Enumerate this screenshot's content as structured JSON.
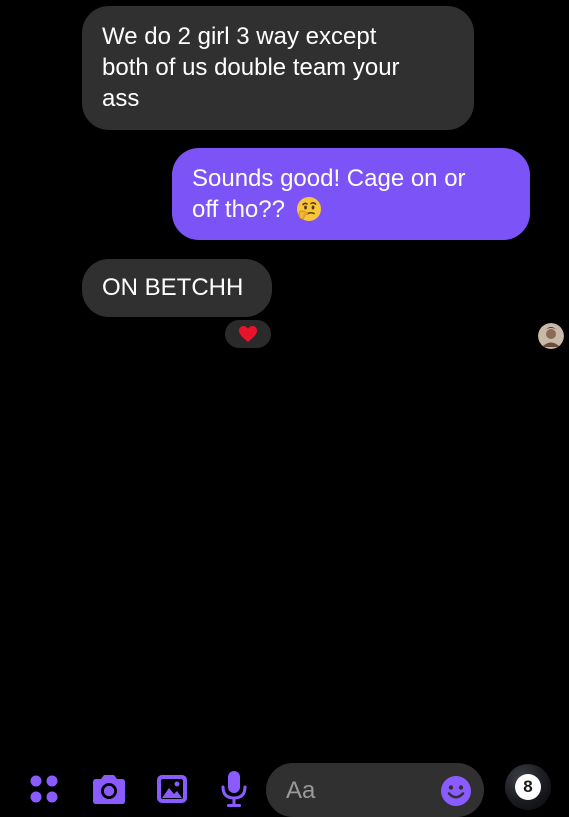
{
  "messages": [
    {
      "direction": "incoming",
      "lines": [
        "We do 2 girl 3 way except",
        "both of us double team your",
        "ass"
      ]
    },
    {
      "direction": "outgoing",
      "lines": [
        "Sounds good! Cage on or",
        "off tho??"
      ],
      "emoji": "thinking-face"
    },
    {
      "direction": "incoming",
      "lines": [
        "ON BETCHH"
      ],
      "reaction": "red-heart"
    }
  ],
  "composer": {
    "placeholder": "Aa",
    "ball_number": "8"
  },
  "colors": {
    "background": "#000000",
    "incoming_bubble": "#303030",
    "outgoing_bubble": "#7b53f7",
    "accent": "#8a5cff",
    "heart": "#e8142c"
  },
  "icons": [
    "menu-icon",
    "camera-icon",
    "gallery-icon",
    "mic-icon",
    "emoji-icon",
    "thinking-face-emoji",
    "heart-icon"
  ]
}
